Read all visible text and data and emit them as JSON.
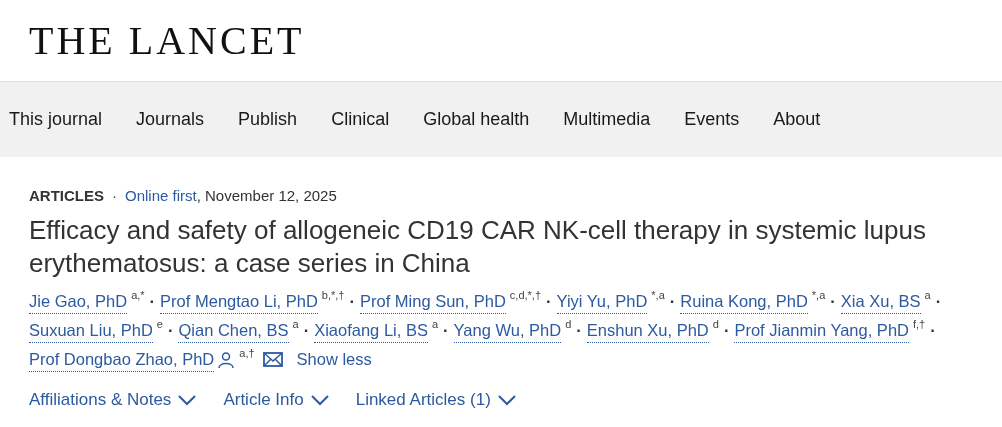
{
  "logo": "THE LANCET",
  "nav": [
    {
      "label": "This journal"
    },
    {
      "label": "Journals"
    },
    {
      "label": "Publish"
    },
    {
      "label": "Clinical"
    },
    {
      "label": "Global health"
    },
    {
      "label": "Multimedia"
    },
    {
      "label": "Events"
    },
    {
      "label": "About"
    }
  ],
  "breadcrumb": {
    "section": "ARTICLES",
    "separator": "·",
    "link": "Online first",
    "date": ", November 12, 2025"
  },
  "title": "Efficacy and safety of allogeneic CD19 CAR NK-cell therapy in systemic lupus erythematosus: a case series in China",
  "authors": [
    {
      "name": "Jie Gao, PhD",
      "marks": "a,*",
      "separator": "·",
      "corresponding": false
    },
    {
      "name": "Prof Mengtao Li, PhD",
      "marks": "b,*,†",
      "separator": "·",
      "corresponding": false
    },
    {
      "name": "Prof Ming Sun, PhD",
      "marks": "c,d,*,†",
      "separator": "·",
      "corresponding": false
    },
    {
      "name": "Yiyi Yu, PhD",
      "marks": "*,a",
      "separator": "·",
      "corresponding": false
    },
    {
      "name": "Ruina Kong, PhD",
      "marks": "*,a",
      "separator": "·",
      "corresponding": false
    },
    {
      "name": "Xia Xu, BS",
      "marks": "a",
      "separator": "·",
      "corresponding": false
    },
    {
      "name": "Suxuan Liu, PhD",
      "marks": "e",
      "separator": "·",
      "corresponding": false
    },
    {
      "name": "Qian Chen, BS",
      "marks": "a",
      "separator": "·",
      "corresponding": false
    },
    {
      "name": "Xiaofang Li, BS",
      "marks": "a",
      "separator": "·",
      "corresponding": false
    },
    {
      "name": "Yang Wu, PhD",
      "marks": "d",
      "separator": "·",
      "corresponding": false
    },
    {
      "name": "Enshun Xu, PhD",
      "marks": "d",
      "separator": "·",
      "corresponding": false
    },
    {
      "name": "Prof Jianmin Yang, PhD",
      "marks": "f,†",
      "separator": "·",
      "corresponding": false
    },
    {
      "name": "Prof Dongbao Zhao, PhD",
      "marks": "a,†",
      "corresponding": true
    }
  ],
  "show_less": "Show less",
  "toggles": [
    {
      "label": "Affiliations & Notes",
      "expanded": false
    },
    {
      "label": "Article Info",
      "expanded": false
    },
    {
      "label": "Linked Articles (1)",
      "expanded": false
    }
  ]
}
